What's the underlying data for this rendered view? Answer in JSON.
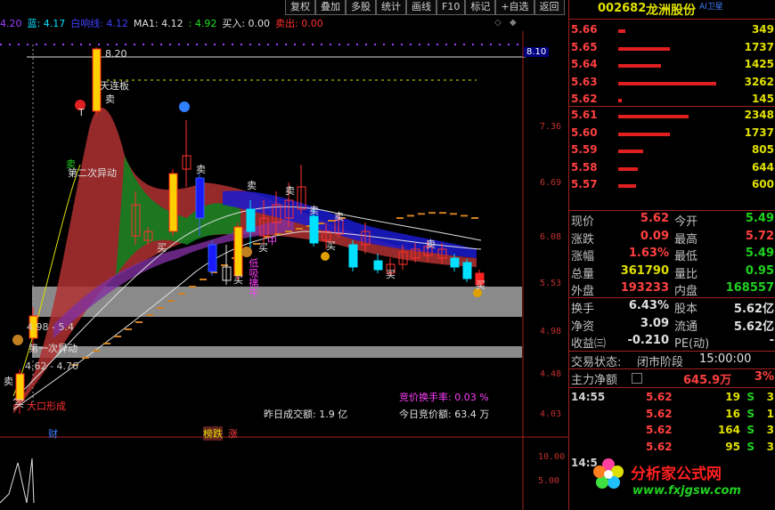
{
  "toolbar": [
    "复权",
    "叠加",
    "多股",
    "统计",
    "画线",
    "F10",
    "标记",
    "+自选",
    "返回"
  ],
  "indicator_bar": {
    "items": [
      {
        "text": "4.20",
        "color": "#a040ff"
      },
      {
        "text": "蓝: 4.17",
        "color": "#00e0ff"
      },
      {
        "text": "白响线: 4.12",
        "color": "#4040ff"
      },
      {
        "text": "MA1: 4.12",
        "color": "#e0e0e0"
      },
      {
        "text": ": 4.92",
        "color": "#20e020"
      },
      {
        "text": "买入: 0.00",
        "color": "#e0e0e0"
      },
      {
        "text": "卖出: 0.00",
        "color": "#ff3030"
      }
    ]
  },
  "price_axis": {
    "labels": [
      "8.10",
      "7.36",
      "6.69",
      "6.08",
      "5.53",
      "4.98",
      "4.48",
      "4.03"
    ],
    "highlight": "8.10"
  },
  "sub_axis": {
    "labels": [
      "10.00",
      "5.00"
    ]
  },
  "chart_labels": {
    "high_price": "8.20",
    "tian_lian_ban": "天连板",
    "second_move": "第二次异动",
    "first_move": "第一次异动",
    "range_low": "4.98 - 5.4",
    "range_low2": "4.62 - 4.76",
    "gap_form": "大口形成",
    "low_suck": "低吸擒牛",
    "niu": "牛",
    "zhong": "中",
    "sell": "卖",
    "buy": "买",
    "flag_cai": "财",
    "flag_bangdie": "榜跌",
    "flag_zhang": "涨",
    "t": "T"
  },
  "auction": {
    "turnover_rate": "竞价换手率: 0.03 %",
    "yesterday_amount": "昨日成交额: 1.9 亿",
    "today_auction": "今日竞价额: 63.4 万"
  },
  "stock": {
    "code": "002682",
    "name": "龙洲股份",
    "tag": "AI卫星"
  },
  "orderbook": {
    "asks": [
      {
        "price": "5.66",
        "vol": "349",
        "w": 0.07
      },
      {
        "price": "5.65",
        "vol": "1737",
        "w": 0.53
      },
      {
        "price": "5.64",
        "vol": "1425",
        "w": 0.44
      },
      {
        "price": "5.63",
        "vol": "3262",
        "w": 1.0
      },
      {
        "price": "5.62",
        "vol": "145",
        "w": 0.04
      }
    ],
    "bids": [
      {
        "price": "5.61",
        "vol": "2348",
        "w": 0.72
      },
      {
        "price": "5.60",
        "vol": "1737",
        "w": 0.53
      },
      {
        "price": "5.59",
        "vol": "805",
        "w": 0.25
      },
      {
        "price": "5.58",
        "vol": "644",
        "w": 0.2
      },
      {
        "price": "5.57",
        "vol": "600",
        "w": 0.18
      }
    ]
  },
  "quotes": [
    {
      "k1": "现价",
      "v1": "5.62",
      "c1": "#ff4040",
      "k2": "今开",
      "v2": "5.49",
      "c2": "#20d020"
    },
    {
      "k1": "涨跌",
      "v1": "0.09",
      "c1": "#ff4040",
      "k2": "最高",
      "v2": "5.72",
      "c2": "#ff4040"
    },
    {
      "k1": "涨幅",
      "v1": "1.63%",
      "c1": "#ff4040",
      "k2": "最低",
      "v2": "5.49",
      "c2": "#20d020"
    },
    {
      "k1": "总量",
      "v1": "361790",
      "c1": "#e0e000",
      "k2": "量比",
      "v2": "0.95",
      "c2": "#20d020"
    },
    {
      "k1": "外盘",
      "v1": "193233",
      "c1": "#ff4040",
      "k2": "内盘",
      "v2": "168557",
      "c2": "#20d020"
    }
  ],
  "quotes2": [
    {
      "k1": "换手",
      "v1": "6.43%",
      "c1": "#e0e0e0",
      "k2": "股本",
      "v2": "5.62亿",
      "c2": "#e0e0e0"
    },
    {
      "k1": "净资",
      "v1": "3.09",
      "c1": "#e0e0e0",
      "k2": "流通",
      "v2": "5.62亿",
      "c2": "#e0e0e0"
    },
    {
      "k1": "收益㈢",
      "v1": "-0.210",
      "c1": "#e0e0e0",
      "k2": "PE(动)",
      "v2": "-",
      "c2": "#e0e0e0"
    }
  ],
  "status": {
    "label": "交易状态:",
    "value": "闭市阶段",
    "time": "15:00:00"
  },
  "mainforce": {
    "label": "主力净额",
    "value": "645.9万",
    "pct": "3%"
  },
  "ticks": [
    {
      "time": "14:55",
      "price": "5.62",
      "vol": "19",
      "side": "S",
      "ex": "3"
    },
    {
      "time": "",
      "price": "5.62",
      "vol": "16",
      "side": "S",
      "ex": "1"
    },
    {
      "time": "",
      "price": "5.62",
      "vol": "164",
      "side": "S",
      "ex": "3"
    },
    {
      "time": "",
      "price": "5.62",
      "vol": "95",
      "side": "S",
      "ex": "3"
    },
    {
      "time": "14:5",
      "price": "",
      "vol": "",
      "side": "",
      "ex": ""
    }
  ],
  "watermark": {
    "site": "分析家公式网",
    "url": "www.fxjgsw.com"
  }
}
